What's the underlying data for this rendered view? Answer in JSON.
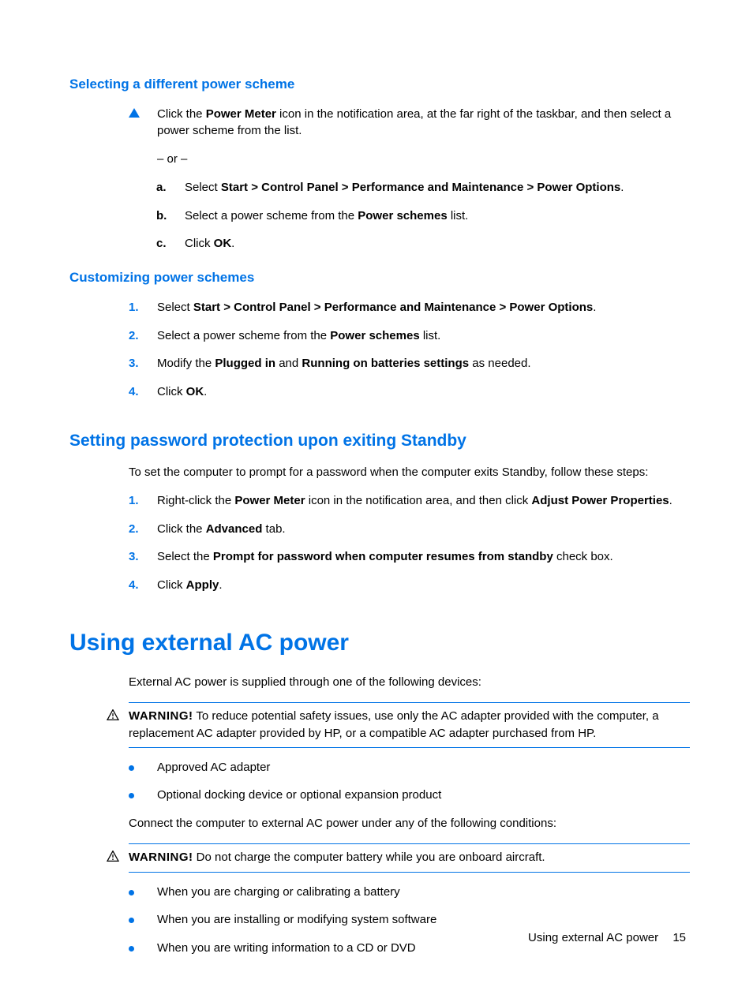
{
  "sec1": {
    "title": "Selecting a different power scheme",
    "p1a": "Click the ",
    "p1b": "Power Meter",
    "p1c": " icon in the notification area, at the far right of the taskbar, and then select a power scheme from the list.",
    "or": "– or –",
    "a_label": "a.",
    "a1": "Select ",
    "a2": "Start > Control Panel > Performance and Maintenance > Power Options",
    "a3": ".",
    "b_label": "b.",
    "b1": "Select a power scheme from the ",
    "b2": "Power schemes",
    "b3": " list.",
    "c_label": "c.",
    "c1": "Click ",
    "c2": "OK",
    "c3": "."
  },
  "sec2": {
    "title": "Customizing power schemes",
    "n1": "1.",
    "s1a": "Select ",
    "s1b": "Start > Control Panel > Performance and Maintenance > Power Options",
    "s1c": ".",
    "n2": "2.",
    "s2a": "Select a power scheme from the ",
    "s2b": "Power schemes",
    "s2c": " list.",
    "n3": "3.",
    "s3a": "Modify the ",
    "s3b": "Plugged in",
    "s3c": " and ",
    "s3d": "Running on batteries settings",
    "s3e": " as needed.",
    "n4": "4.",
    "s4a": "Click ",
    "s4b": "OK",
    "s4c": "."
  },
  "sec3": {
    "title": "Setting password protection upon exiting Standby",
    "intro": "To set the computer to prompt for a password when the computer exits Standby, follow these steps:",
    "n1": "1.",
    "s1a": "Right-click the ",
    "s1b": "Power Meter",
    "s1c": " icon in the notification area, and then click ",
    "s1d": "Adjust Power Properties",
    "s1e": ".",
    "n2": "2.",
    "s2a": "Click the ",
    "s2b": "Advanced",
    "s2c": " tab.",
    "n3": "3.",
    "s3a": "Select the ",
    "s3b": "Prompt for password when computer resumes from standby",
    "s3c": " check box.",
    "n4": "4.",
    "s4a": "Click ",
    "s4b": "Apply",
    "s4c": "."
  },
  "sec4": {
    "title": "Using external AC power",
    "intro": "External AC power is supplied through one of the following devices:",
    "warn1_label": "WARNING!",
    "warn1_text": "  To reduce potential safety issues, use only the AC adapter provided with the computer, a replacement AC adapter provided by HP, or a compatible AC adapter purchased from HP.",
    "b1": "Approved AC adapter",
    "b2": "Optional docking device or optional expansion product",
    "intro2": "Connect the computer to external AC power under any of the following conditions:",
    "warn2_label": "WARNING!",
    "warn2_text": "  Do not charge the computer battery while you are onboard aircraft.",
    "b3": "When you are charging or calibrating a battery",
    "b4": "When you are installing or modifying system software",
    "b5": "When you are writing information to a CD or DVD"
  },
  "footer": {
    "text": "Using external AC power",
    "page": "15"
  }
}
